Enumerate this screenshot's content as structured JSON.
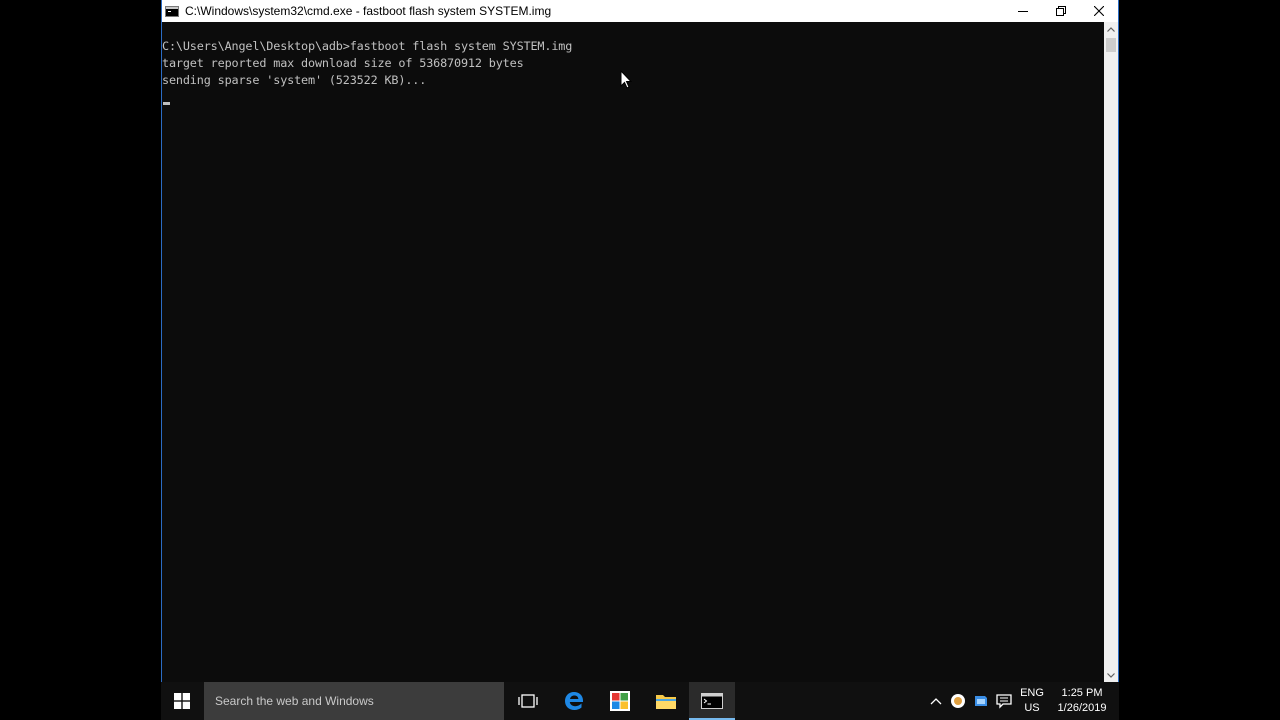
{
  "window": {
    "title": "C:\\Windows\\system32\\cmd.exe - fastboot  flash system SYSTEM.img",
    "controls": {
      "minimize": "minimize-icon",
      "restore": "restore-icon",
      "close": "close-icon"
    }
  },
  "console": {
    "lines": [
      "C:\\Users\\Angel\\Desktop\\adb>fastboot flash system SYSTEM.img",
      "target reported max download size of 536870912 bytes",
      "sending sparse 'system' (523522 KB)..."
    ],
    "text_color": "#c0c0c0",
    "background": "#0c0c0c"
  },
  "taskbar": {
    "search_placeholder": "Search the web and Windows",
    "pinned": [
      "task-view-icon",
      "edge-icon",
      "store-icon",
      "file-explorer-icon",
      "command-prompt-icon"
    ],
    "active_app": "command-prompt",
    "accent": "#76b9ed",
    "tray": {
      "language": "ENG",
      "region": "US",
      "time": "1:25 PM",
      "date": "1/26/2019"
    }
  }
}
